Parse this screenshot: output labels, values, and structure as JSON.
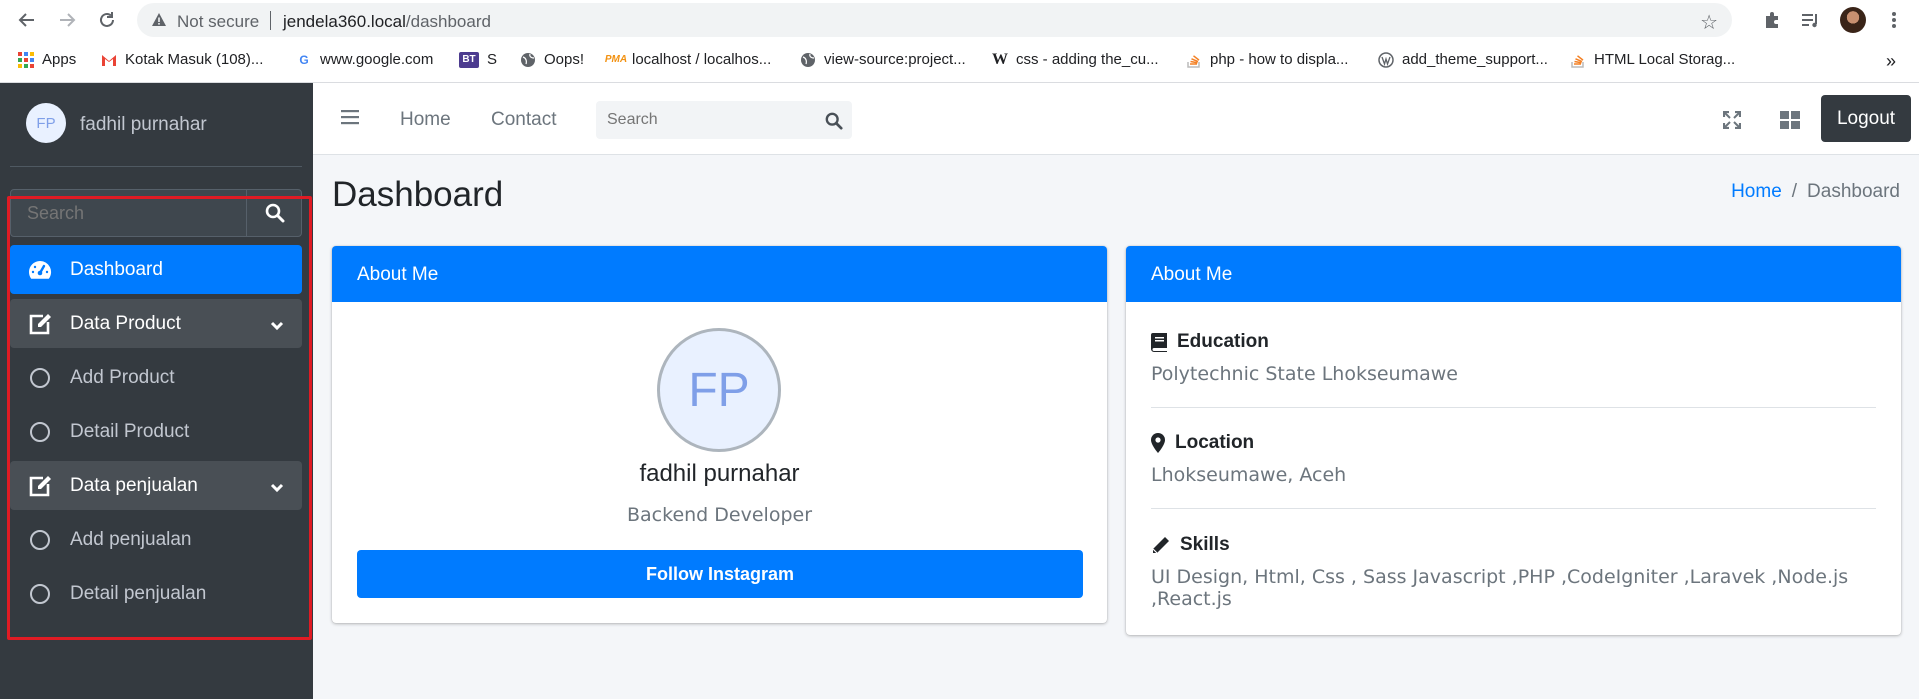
{
  "browser": {
    "security_label": "Not secure",
    "url_host": "jendela360.local",
    "url_path": "/dashboard",
    "bookmarks": [
      {
        "label": "Apps"
      },
      {
        "label": "Kotak Masuk (108)..."
      },
      {
        "label": "www.google.com"
      },
      {
        "label": "S"
      },
      {
        "label": "Oops!"
      },
      {
        "label": "localhost / localhos..."
      },
      {
        "label": "view-source:project..."
      },
      {
        "label": "css - adding the_cu..."
      },
      {
        "label": "php - how to displa..."
      },
      {
        "label": "add_theme_support..."
      },
      {
        "label": "HTML Local Storag..."
      }
    ],
    "bookmarks_overflow": "»"
  },
  "sidebar": {
    "user_initials": "FP",
    "user_name": "fadhil purnahar",
    "search_placeholder": "Search",
    "items": [
      {
        "label": "Dashboard",
        "icon": "tachometer-icon"
      },
      {
        "label": "Data Product",
        "icon": "edit-icon"
      },
      {
        "label": "Add Product",
        "icon": "circle-icon"
      },
      {
        "label": "Detail Product",
        "icon": "circle-icon"
      },
      {
        "label": "Data penjualan",
        "icon": "edit-icon"
      },
      {
        "label": "Add penjualan",
        "icon": "circle-icon"
      },
      {
        "label": "Detail penjualan",
        "icon": "circle-icon"
      }
    ]
  },
  "topnav": {
    "links": [
      "Home",
      "Contact"
    ],
    "search_placeholder": "Search",
    "logout_label": "Logout"
  },
  "header": {
    "title": "Dashboard",
    "breadcrumb": [
      "Home",
      "Dashboard"
    ],
    "breadcrumb_separator": "/"
  },
  "profile_card": {
    "title": "About Me",
    "initials": "FP",
    "name": "fadhil purnahar",
    "role": "Backend Developer",
    "button_label": "Follow Instagram"
  },
  "about_card": {
    "title": "About Me",
    "sections": [
      {
        "heading": "Education",
        "icon": "book-icon",
        "text": "Polytechnic State Lhokseumawe"
      },
      {
        "heading": "Location",
        "icon": "map-marker-icon",
        "text": "Lhokseumawe, Aceh"
      },
      {
        "heading": "Skills",
        "icon": "pencil-icon",
        "text": "UI Design, Html, Css , Sass Javascript ,PHP ,CodeIgniter ,Laravek ,Node.js ,React.js"
      }
    ]
  },
  "colors": {
    "primary": "#007bff",
    "sidebar_bg": "#343a40",
    "highlight": "#e01b24"
  }
}
